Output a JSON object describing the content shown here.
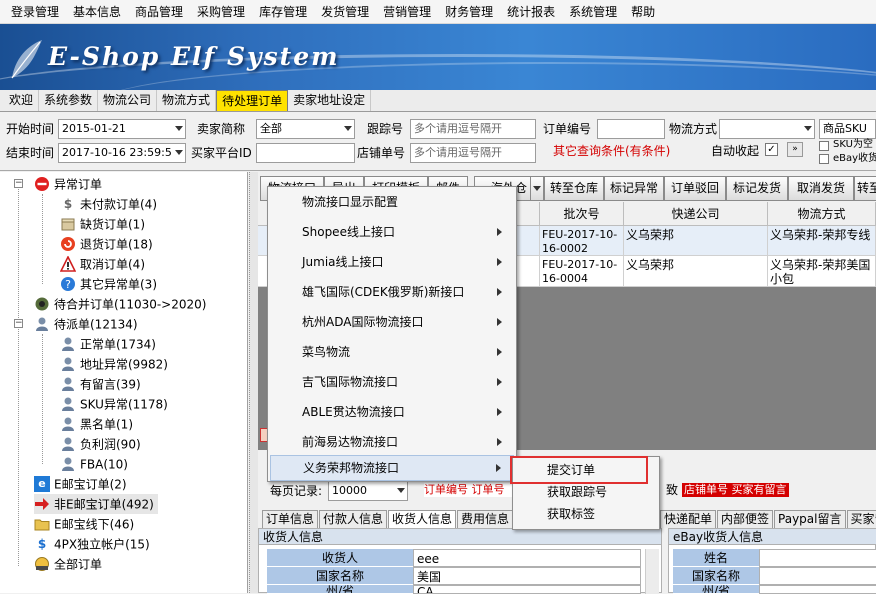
{
  "menubar": [
    "登录管理",
    "基本信息",
    "商品管理",
    "采购管理",
    "库存管理",
    "发货管理",
    "营销管理",
    "财务管理",
    "统计报表",
    "系统管理",
    "帮助"
  ],
  "banner": {
    "title": "E-Shop Elf System"
  },
  "tabs": [
    {
      "label": "欢迎",
      "active": false
    },
    {
      "label": "系统参数",
      "active": false
    },
    {
      "label": "物流公司",
      "active": false
    },
    {
      "label": "物流方式",
      "active": false
    },
    {
      "label": "待处理订单",
      "active": true
    },
    {
      "label": "卖家地址设定",
      "active": false
    }
  ],
  "filters": {
    "start_label": "开始时间",
    "start_value": "2015-01-21",
    "end_label": "结束时间",
    "end_value": "2017-10-16 23:59:5",
    "seller_label": "卖家简称",
    "seller_value": "全部",
    "platform_label": "买家平台ID",
    "tracking_label": "跟踪号",
    "tracking_placeholder": "多个请用逗号隔开",
    "shop_no_label": "店铺单号",
    "shop_no_placeholder": "多个请用逗号隔开",
    "order_no_label": "订单编号",
    "logistics_label": "物流方式",
    "other_conditions": "其它查询条件(有条件)",
    "auto_collapse_label": "自动收起",
    "sku_label": "商品SKU",
    "sku_empty": "SKU为空",
    "ebay_collect": "eBay收货"
  },
  "tree": {
    "items": [
      {
        "label": "异常订单",
        "icon": "no-entry-icon"
      },
      {
        "label": "未付款订单(4)",
        "icon": "dollar-icon"
      },
      {
        "label": "缺货订单(1)",
        "icon": "box-icon"
      },
      {
        "label": "退货订单(18)",
        "icon": "return-icon"
      },
      {
        "label": "取消订单(4)",
        "icon": "warning-icon"
      },
      {
        "label": "其它异常单(3)",
        "icon": "question-icon"
      },
      {
        "label": "待合并订单(11030->2020)",
        "icon": "gear-icon"
      },
      {
        "label": "待派单(12134)",
        "icon": "user-icon"
      },
      {
        "label": "正常单(1734)",
        "icon": "user-icon"
      },
      {
        "label": "地址异常(9982)",
        "icon": "user-icon"
      },
      {
        "label": "有留言(39)",
        "icon": "user-icon"
      },
      {
        "label": "SKU异常(1178)",
        "icon": "user-icon"
      },
      {
        "label": "黑名单(1)",
        "icon": "user-icon"
      },
      {
        "label": "负利润(90)",
        "icon": "user-icon"
      },
      {
        "label": "FBA(10)",
        "icon": "user-icon"
      },
      {
        "label": "E邮宝订单(2)",
        "icon": "e-icon"
      },
      {
        "label": "非E邮宝订单(492)",
        "icon": "arrow-icon"
      },
      {
        "label": "E邮宝线下(46)",
        "icon": "folder-icon"
      },
      {
        "label": "4PX独立帐户(15)",
        "icon": "dollar-icon"
      },
      {
        "label": "全部订单",
        "icon": "globe-icon"
      }
    ]
  },
  "toolbar": {
    "buttons": [
      "物流接口",
      "导出",
      "打印模板",
      "邮件",
      "海外仓",
      "转至仓库",
      "标记异常",
      "订单驳回",
      "标记发货",
      "取消发货",
      "转至"
    ]
  },
  "grid": {
    "headers": [
      "批次号",
      "快递公司",
      "物流方式"
    ],
    "rows": [
      {
        "batch": "FEU-2017-10-16-0002",
        "courier": "义乌荣邦",
        "method": "义乌荣邦-荣邦专线"
      },
      {
        "batch": "FEU-2017-10-16-0004",
        "courier": "义乌荣邦",
        "method": "义乌荣邦-荣邦美国小包"
      }
    ]
  },
  "context_menu": {
    "items": [
      {
        "label": "物流接口显示配置",
        "has_sub": false
      },
      {
        "label": "Shopee线上接口",
        "has_sub": true
      },
      {
        "label": "Jumia线上接口",
        "has_sub": true
      },
      {
        "label": "雄飞国际(CDEK俄罗斯)新接口",
        "has_sub": true
      },
      {
        "label": "杭州ADA国际物流接口",
        "has_sub": true
      },
      {
        "label": "菜鸟物流",
        "has_sub": true
      },
      {
        "label": "吉飞国际物流接口",
        "has_sub": true
      },
      {
        "label": "ABLE贯达物流接口",
        "has_sub": true
      },
      {
        "label": "前海易达物流接口",
        "has_sub": true
      },
      {
        "label": "义务荣邦物流接口",
        "has_sub": true
      }
    ],
    "submenu": [
      "提交订单",
      "获取跟踪号",
      "获取标签"
    ]
  },
  "paging": {
    "label": "每页记录:",
    "value": "10000"
  },
  "legend": {
    "left": "订单编号 订单号",
    "right_a": "致",
    "right_b": "店铺单号 买家有留言"
  },
  "bottom_tabs": [
    "订单信息",
    "付款人信息",
    "收货人信息",
    "费用信息"
  ],
  "bottom_tabs_right": [
    "快递配单",
    "内部便签",
    "Paypal留言",
    "买家留言"
  ],
  "consignee": {
    "section": "收货人信息",
    "fields": [
      {
        "label": "收货人",
        "value": "eee"
      },
      {
        "label": "国家名称",
        "value": "美国"
      },
      {
        "label": "州/省",
        "value": "CA"
      }
    ]
  },
  "ebay_consignee": {
    "section": "eBay收货人信息",
    "fields": [
      {
        "label": "姓名"
      },
      {
        "label": "国家名称"
      },
      {
        "label": "州/省"
      }
    ]
  },
  "colors": {
    "accent": "#ffe200",
    "banner": "#2f6fbd",
    "alert": "#d40000"
  }
}
